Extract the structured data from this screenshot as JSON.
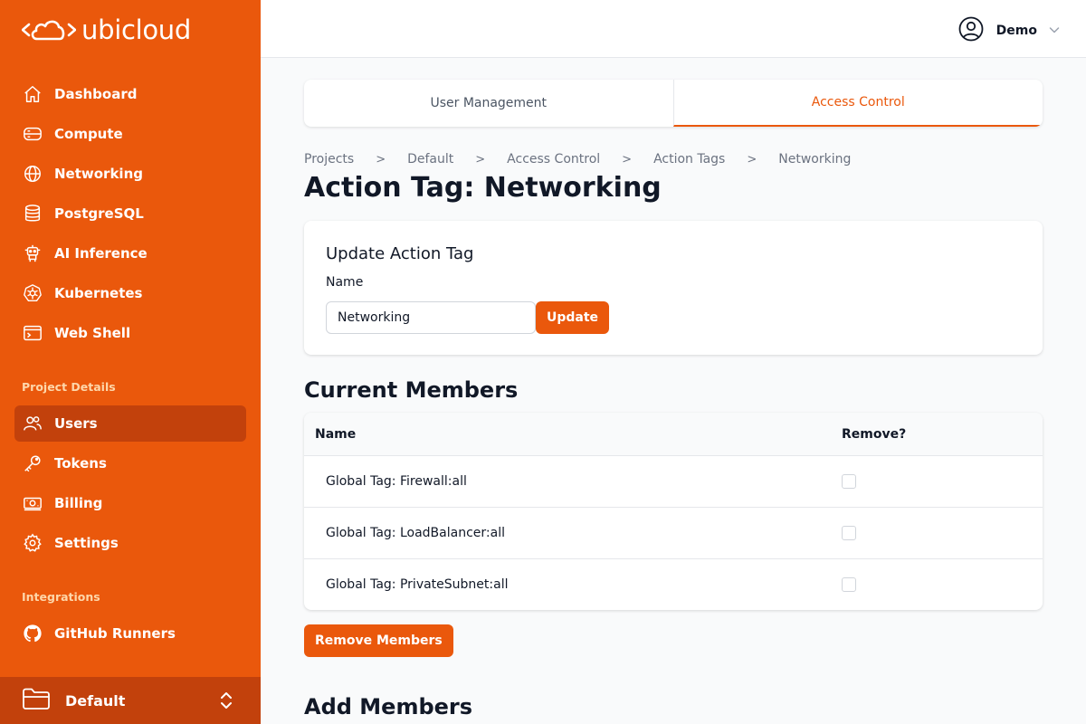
{
  "app": {
    "logo_text": "ubicloud"
  },
  "sidebar": {
    "items": [
      {
        "label": "Dashboard"
      },
      {
        "label": "Compute"
      },
      {
        "label": "Networking"
      },
      {
        "label": "PostgreSQL"
      },
      {
        "label": "AI Inference"
      },
      {
        "label": "Kubernetes"
      },
      {
        "label": "Web Shell"
      }
    ],
    "project_details_label": "Project Details",
    "project_items": [
      {
        "label": "Users",
        "active": true
      },
      {
        "label": "Tokens"
      },
      {
        "label": "Billing"
      },
      {
        "label": "Settings"
      }
    ],
    "integrations_label": "Integrations",
    "integration_items": [
      {
        "label": "GitHub Runners"
      }
    ],
    "project_switcher": {
      "label": "Default"
    }
  },
  "header": {
    "user_name": "Demo"
  },
  "tabs": [
    {
      "label": "User Management"
    },
    {
      "label": "Access Control",
      "active": true
    }
  ],
  "breadcrumb": [
    "Projects",
    "Default",
    "Access Control",
    "Action Tags",
    "Networking"
  ],
  "page": {
    "title": "Action Tag: Networking"
  },
  "update_form": {
    "title": "Update Action Tag",
    "name_label": "Name",
    "name_value": "Networking",
    "submit_label": "Update"
  },
  "current_members": {
    "title": "Current Members",
    "columns": [
      "Name",
      "Remove?"
    ],
    "rows": [
      {
        "name": "Global Tag: Firewall:all",
        "checked": false
      },
      {
        "name": "Global Tag: LoadBalancer:all",
        "checked": false
      },
      {
        "name": "Global Tag: PrivateSubnet:all",
        "checked": false
      }
    ],
    "remove_button": "Remove Members"
  },
  "add_members": {
    "title": "Add Members"
  },
  "colors": {
    "brand": "#ea580c",
    "brand_dark": "#c2410c",
    "text": "#111827",
    "muted": "#6b7280"
  }
}
